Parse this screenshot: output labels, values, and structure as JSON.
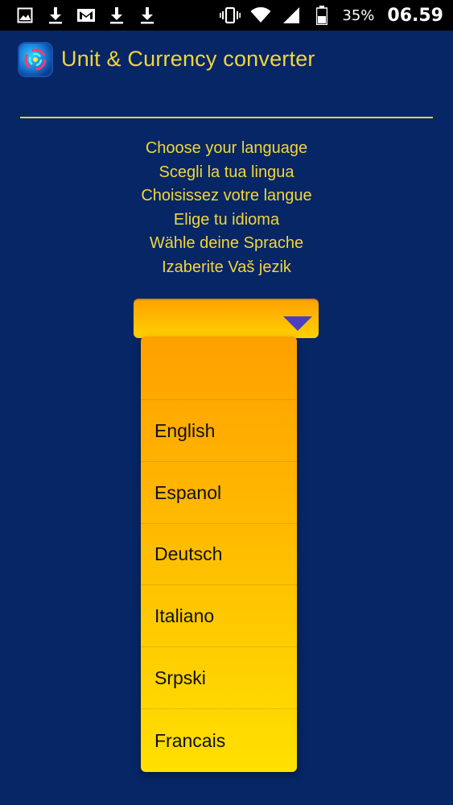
{
  "status_bar": {
    "left_icons": [
      "image-icon",
      "download-icon",
      "gmail-icon",
      "download-icon",
      "download-icon"
    ],
    "right_icons": [
      "vibrate-icon",
      "wifi-icon",
      "signal-icon",
      "battery-icon"
    ],
    "battery_percent": "35%",
    "time": "06.59"
  },
  "header": {
    "title": "Unit & Currency converter",
    "logo_icon": "app-logo-icon"
  },
  "prompts": [
    "Choose your language",
    "Scegli la tua lingua",
    "Choisissez votre langue",
    "Elige tu idioma",
    "Wähle deine Sprache",
    "Izaberite Vaš jezik"
  ],
  "spinner": {
    "selected_value": "",
    "arrow_icon": "dropdown-arrow-icon"
  },
  "dropdown": {
    "items": [
      "",
      "English",
      "Espanol",
      "Deutsch",
      "Italiano",
      "Srpski",
      "Francais"
    ]
  },
  "colors": {
    "background": "#062666",
    "accent_text": "#f2d63a",
    "dropdown_top": "#ffa000",
    "dropdown_bottom": "#ffe000",
    "arrow": "#4b3fbf"
  }
}
